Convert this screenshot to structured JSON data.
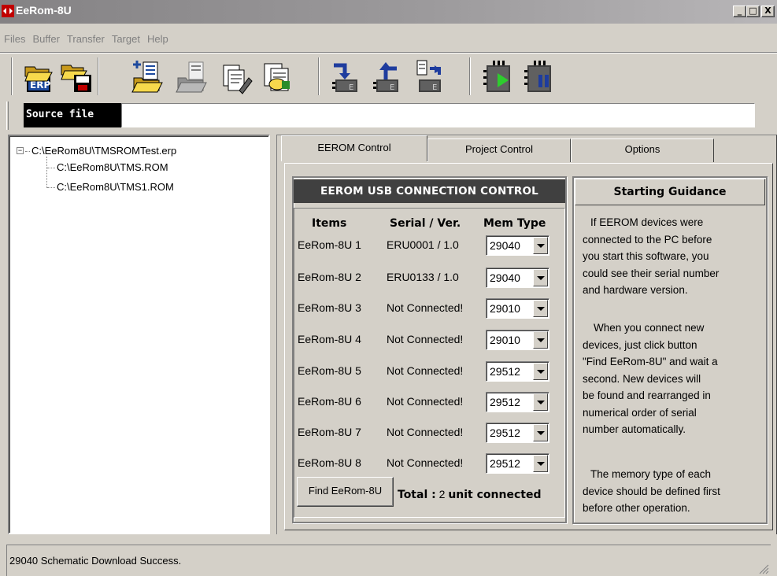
{
  "window": {
    "title": "EeRom-8U",
    "controls": {
      "minimize": "_",
      "maximize": "□",
      "close": "X"
    }
  },
  "menu": [
    "Files",
    "Buffer",
    "Transfer",
    "Target",
    "Help"
  ],
  "toolbar": {
    "buttons": [
      {
        "icon": "open-project-icon",
        "text": "ERP"
      },
      {
        "icon": "save-project-icon"
      },
      {
        "icon": "add-file-icon"
      },
      {
        "icon": "remove-file-icon"
      },
      {
        "icon": "edit-file-icon"
      },
      {
        "icon": "file-properties-icon"
      },
      {
        "icon": "upload-to-device-icon",
        "text": "E"
      },
      {
        "icon": "download-from-device-icon",
        "text": "E"
      },
      {
        "icon": "compare-icon",
        "text": "E"
      },
      {
        "icon": "run-emulation-icon"
      },
      {
        "icon": "pause-emulation-icon"
      }
    ]
  },
  "source": {
    "label": "Source file",
    "value": ""
  },
  "tree": {
    "root": "C:\\EeRom8U\\TMSROMTest.erp",
    "children": [
      "C:\\EeRom8U\\TMS.ROM",
      "C:\\EeRom8U\\TMS1.ROM"
    ],
    "expander": "−"
  },
  "tabs": [
    "EEROM Control",
    "Project Control",
    "Options"
  ],
  "connection": {
    "header": "EEROM USB CONNECTION CONTROL",
    "columns": [
      "Items",
      "Serial / Ver.",
      "Mem Type"
    ],
    "rows": [
      {
        "name": "EeRom-8U 1",
        "serial": "ERU0001 / 1.0",
        "mem": "29040"
      },
      {
        "name": "EeRom-8U 2",
        "serial": "ERU0133 / 1.0",
        "mem": "29040"
      },
      {
        "name": "EeRom-8U 3",
        "serial": "Not Connected!",
        "mem": "29010"
      },
      {
        "name": "EeRom-8U 4",
        "serial": "Not Connected!",
        "mem": "29010"
      },
      {
        "name": "EeRom-8U 5",
        "serial": "Not Connected!",
        "mem": "29512"
      },
      {
        "name": "EeRom-8U 6",
        "serial": "Not Connected!",
        "mem": "29512"
      },
      {
        "name": "EeRom-8U 7",
        "serial": "Not Connected!",
        "mem": "29512"
      },
      {
        "name": "EeRom-8U 8",
        "serial": "Not Connected!",
        "mem": "29512"
      }
    ],
    "find_button": "Find EeRom-8U",
    "total_label": "Total :",
    "total_count": "2",
    "total_suffix": "unit connected"
  },
  "guidance": {
    "title": "Starting Guidance",
    "p1": [
      "If EEROM devices were",
      "connected to the PC before",
      "you start this software, you",
      "could see their serial number",
      "and hardware version."
    ],
    "p2": [
      "When you connect new",
      "devices, just click button",
      "\"Find  EeRom-8U\" and wait a",
      "second. New devices will",
      "be found and rearranged in",
      "numerical order of serial",
      "number automatically."
    ],
    "p3": [
      "The memory type of each",
      "device should be defined first",
      "before other operation."
    ]
  },
  "status": {
    "text": "29040 Schematic Download Success."
  }
}
